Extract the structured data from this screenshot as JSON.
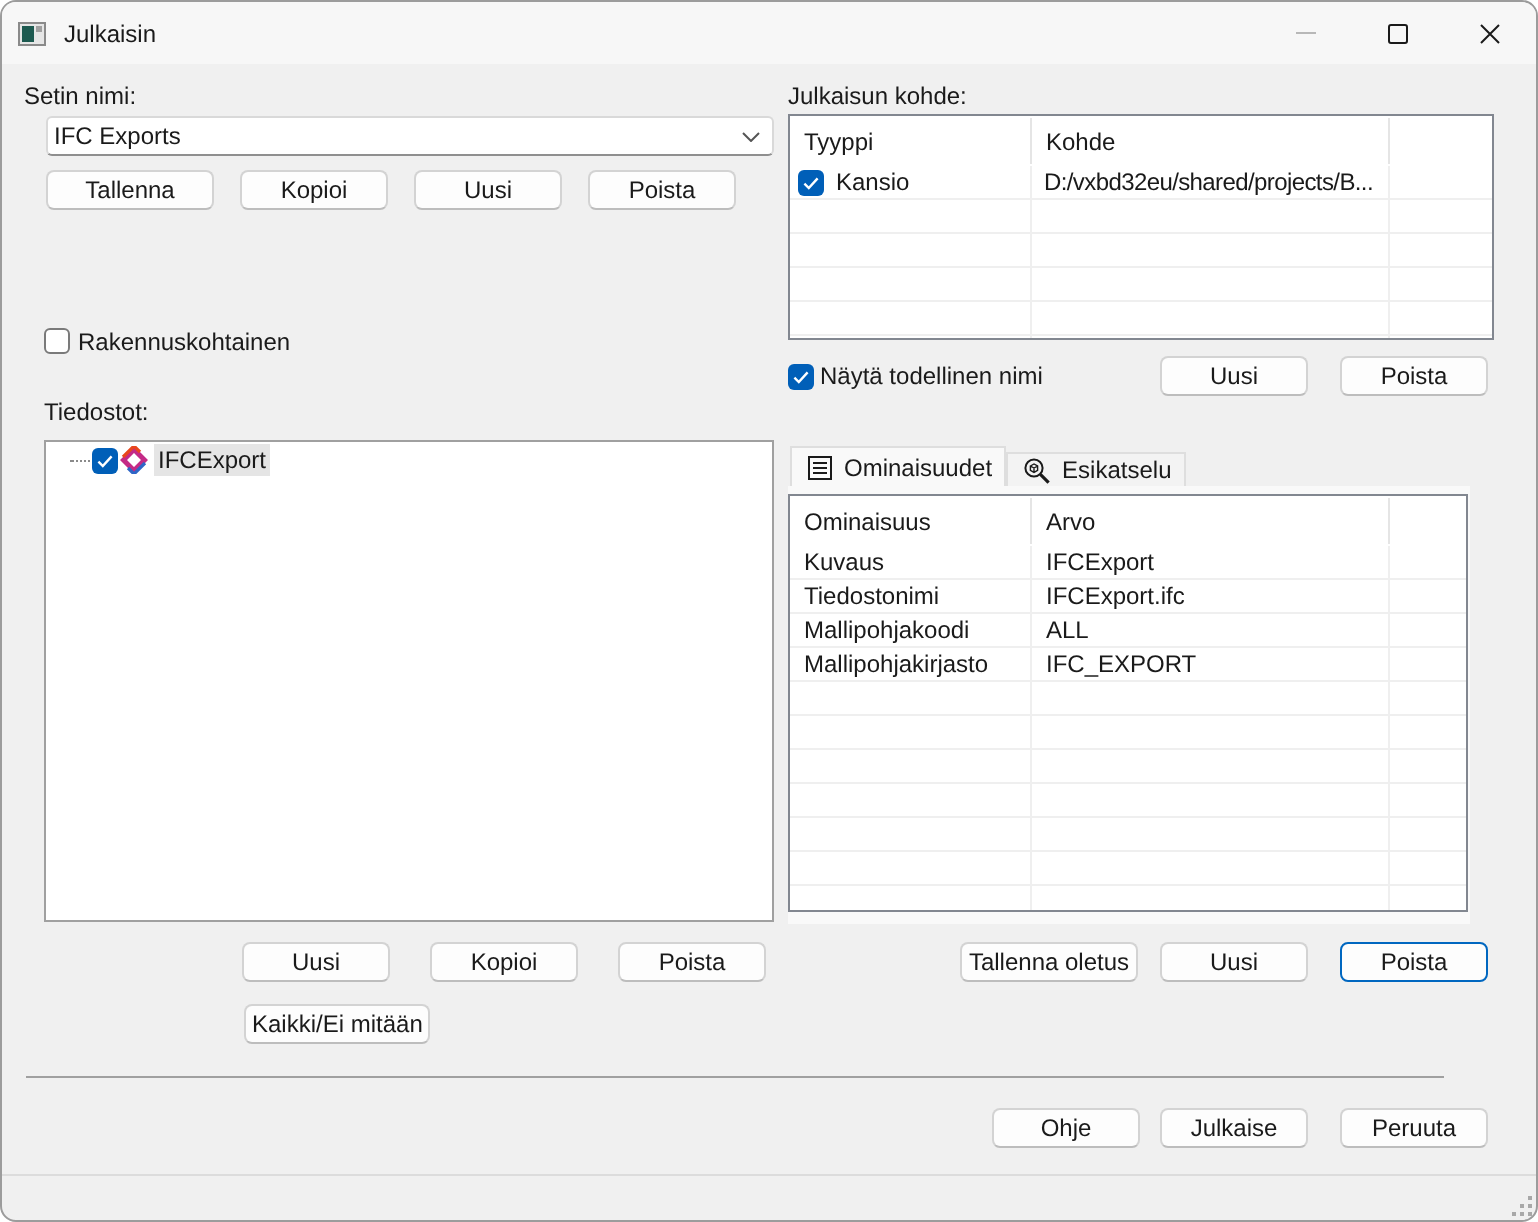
{
  "window": {
    "title": "Julkaisin",
    "controls": [
      {
        "kind": "minimize",
        "disabled": true
      },
      {
        "kind": "maximize",
        "disabled": false
      },
      {
        "kind": "close",
        "disabled": false
      }
    ]
  },
  "set": {
    "label": "Setin nimi:",
    "value": "IFC Exports",
    "buttons": [
      "Tallenna",
      "Kopioi",
      "Uusi",
      "Poista"
    ]
  },
  "target": {
    "label": "Julkaisun kohde:",
    "columns": [
      "Tyyppi",
      "Kohde"
    ],
    "rows": [
      {
        "checked": true,
        "type": "Kansio",
        "target": "D:/vxbd32eu/shared/projects/B..."
      }
    ],
    "show_real_name": {
      "label": "Näytä todellinen nimi",
      "checked": true
    },
    "buttons": [
      "Uusi",
      "Poista"
    ]
  },
  "building_specific": {
    "label": "Rakennuskohtainen",
    "checked": false
  },
  "files": {
    "label": "Tiedostot:",
    "tree": [
      {
        "label": "IFCExport",
        "checked": true,
        "selected": true
      }
    ],
    "buttons": [
      "Uusi",
      "Kopioi",
      "Poista"
    ],
    "toggle_all_button": "Kaikki/Ei mitään"
  },
  "tabs": [
    {
      "label": "Ominaisuudet",
      "selected": true
    },
    {
      "label": "Esikatselu",
      "selected": false
    }
  ],
  "properties": {
    "columns": [
      "Ominaisuus",
      "Arvo"
    ],
    "rows": [
      {
        "name": "Kuvaus",
        "value": "IFCExport"
      },
      {
        "name": "Tiedostonimi",
        "value": "IFCExport.ifc"
      },
      {
        "name": "Mallipohjakoodi",
        "value": "ALL"
      },
      {
        "name": "Mallipohjakirjasto",
        "value": "IFC_EXPORT"
      }
    ],
    "buttons": [
      {
        "label": "Tallenna oletus",
        "focused": false
      },
      {
        "label": "Uusi",
        "focused": false
      },
      {
        "label": "Poista",
        "focused": true
      }
    ]
  },
  "footer_buttons": [
    "Ohje",
    "Julkaise",
    "Peruuta"
  ]
}
